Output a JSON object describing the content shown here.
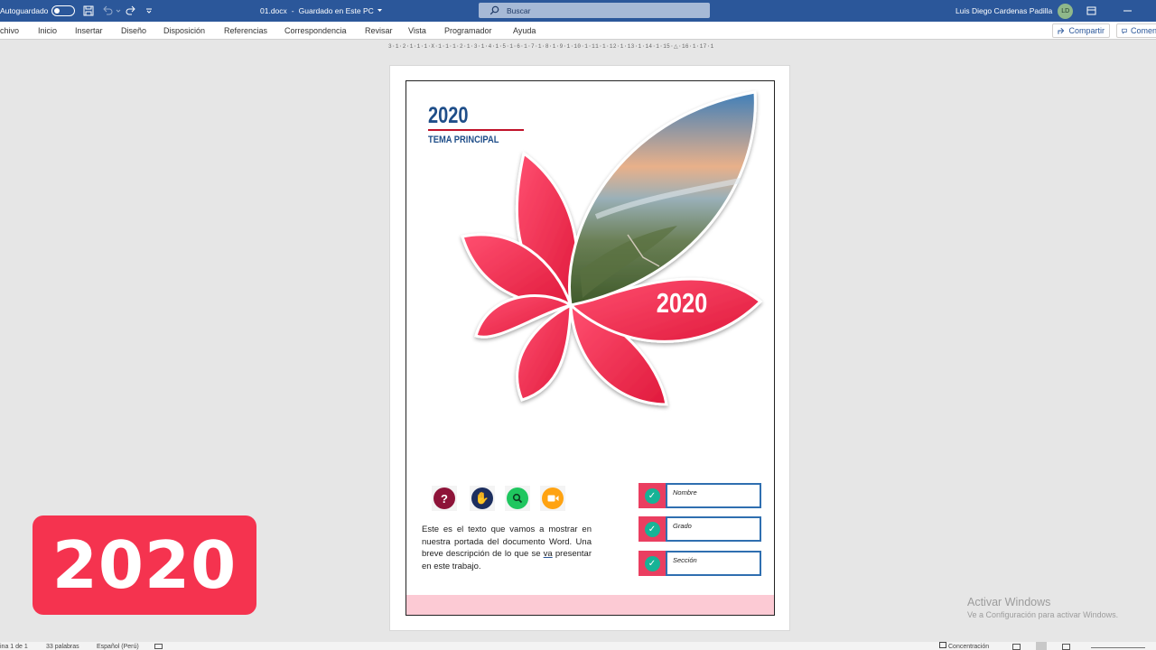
{
  "titlebar": {
    "autosave_label": "Autoguardado",
    "filename": "01.docx",
    "sep": "-",
    "saved_status": "Guardado en Este PC",
    "search_placeholder": "Buscar",
    "user_name": "Luis Diego Cardenas Padilla",
    "user_initials": "LD"
  },
  "ribbon": {
    "tabs": [
      "chivo",
      "Inicio",
      "Insertar",
      "Diseño",
      "Disposición",
      "Referencias",
      "Correspondencia",
      "Revisar",
      "Vista",
      "Programador",
      "Ayuda"
    ],
    "share_label": "Compartir",
    "comments_label": "Comen"
  },
  "ruler": {
    "text": "3·1·2·1·1·1·X·1·1·1·2·1·3·1·4·1·5·1·6·1·7·1·8·1·9·1·10·1·11·1·12·1·13·1·14·1·15·△·16·1·17·1"
  },
  "document": {
    "year": "2020",
    "theme": "TEMA PRINCIPAL",
    "flower_year": "2020",
    "description_before": "Este es el texto que vamos a mostrar en nuestra portada del documento Word. Una breve descripción de lo que se ",
    "description_underlined": "va",
    "description_after": " presentar en este trabajo.",
    "icons": [
      "question-icon",
      "hand-icon",
      "search-icon",
      "video-icon"
    ],
    "fields": [
      "Nombre",
      "Grado",
      "Sección"
    ],
    "colors": {
      "accent": "#f5334f",
      "title_blue": "#1f4e89",
      "band_pink": "#fccad4"
    }
  },
  "badge": {
    "text": "2020"
  },
  "watermark": {
    "line1": "Activar Windows",
    "line2": "Ve a Configuración para activar Windows."
  },
  "status": {
    "page": "ina 1 de 1",
    "words": "33 palabras",
    "language": "Español (Perú)",
    "focus": "Concentración"
  }
}
